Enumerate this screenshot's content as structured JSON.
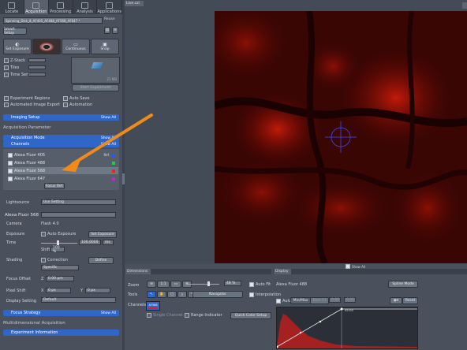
{
  "tabs": [
    "Locate",
    "Acquisition",
    "Processing",
    "Analysis",
    "Applications"
  ],
  "experiment": {
    "name": "Spinning_Disk_8_AF405_AF488_AF568_AF647 *",
    "reuse": "Reuse"
  },
  "smart_setup": "Smart Setup",
  "actions": {
    "set_exposure": "Set Exposure",
    "continuous": "Continuous",
    "snap": "Snap"
  },
  "options": {
    "z_stack": "Z-Stack",
    "tiles": "Tiles",
    "time_series": "Time Series",
    "start": "Start Experiment",
    "size": "21 MB"
  },
  "extra": {
    "experiment_regions": "Experiment Regions",
    "auto_save": "Auto Save",
    "automated_export": "Automated Image Export",
    "automation": "Automation"
  },
  "imaging_setup": "Imaging Setup",
  "show_all": "Show All",
  "acquisition_parameter": "Acquisition Parameter",
  "acquisition_mode": "Acquisition Mode",
  "channels_bar": "Channels",
  "channels": [
    {
      "name": "Alexa Fluor 405",
      "ref": "Ref.",
      "color": "#3355ff"
    },
    {
      "name": "Alexa Fluor 488",
      "ref": "",
      "color": "#22cc44"
    },
    {
      "name": "Alexa Fluor 568",
      "ref": "",
      "color": "#ee2222"
    },
    {
      "name": "Alexa Fluor 647",
      "ref": "",
      "color": "#cc22cc"
    }
  ],
  "focus_ref": "Focus Ref.",
  "lightsource": {
    "label": "Lightsource",
    "value": "Use Setting"
  },
  "channel_name": "Alexa Fluor 568",
  "camera": {
    "label": "Camera",
    "value": "Flash 4.0"
  },
  "exposure": {
    "label": "Exposure",
    "auto": "Auto Exposure",
    "set": "Set Exposure",
    "time": "Time",
    "time_value": "100.0000",
    "unit": "ms",
    "shift": "Shift",
    "shift_value": "100 %"
  },
  "shading": {
    "label": "Shading",
    "correction": "Correction",
    "define": "Define",
    "mode": "Specific"
  },
  "focus_offset": {
    "label": "Focus Offset",
    "axis": "Z",
    "value": "0.00 µm"
  },
  "pixel_shift": {
    "label": "Pixel Shift",
    "x": "X",
    "x_value": "0 px",
    "y": "Y",
    "y_value": "0 px"
  },
  "display_setting": {
    "label": "Display Setting",
    "value": "Default"
  },
  "focus_strategy": "Focus Strategy",
  "multidim": "Multidimensional Acquisition",
  "experiment_info": "Experiment Information",
  "viewer": {
    "tab": "Live.czi",
    "show_all": "Show All"
  },
  "dimensions": {
    "tab": "Dimensions",
    "zoom": "Zoom",
    "zoom_value": "48 %",
    "auto_fit": "Auto Fit",
    "tools": "Tools",
    "navigator": "Navigator",
    "interpolation": "Interpolation",
    "channels": "Channels",
    "channel_chip": "AF568",
    "single_channel": "Single Channel",
    "range_indicator": "Range Indicator",
    "quick_color": "Quick Color Setup"
  },
  "display": {
    "tab": "Display",
    "channel": "Alexa Fluor 488",
    "spline": "Spline Mode",
    "auto": "Auto",
    "minmax": "Min/Max",
    "bestfit": "Best Fit",
    "v1": "0.00",
    "v2": "0.01",
    "reset": "Reset",
    "hist_top": "65000"
  }
}
